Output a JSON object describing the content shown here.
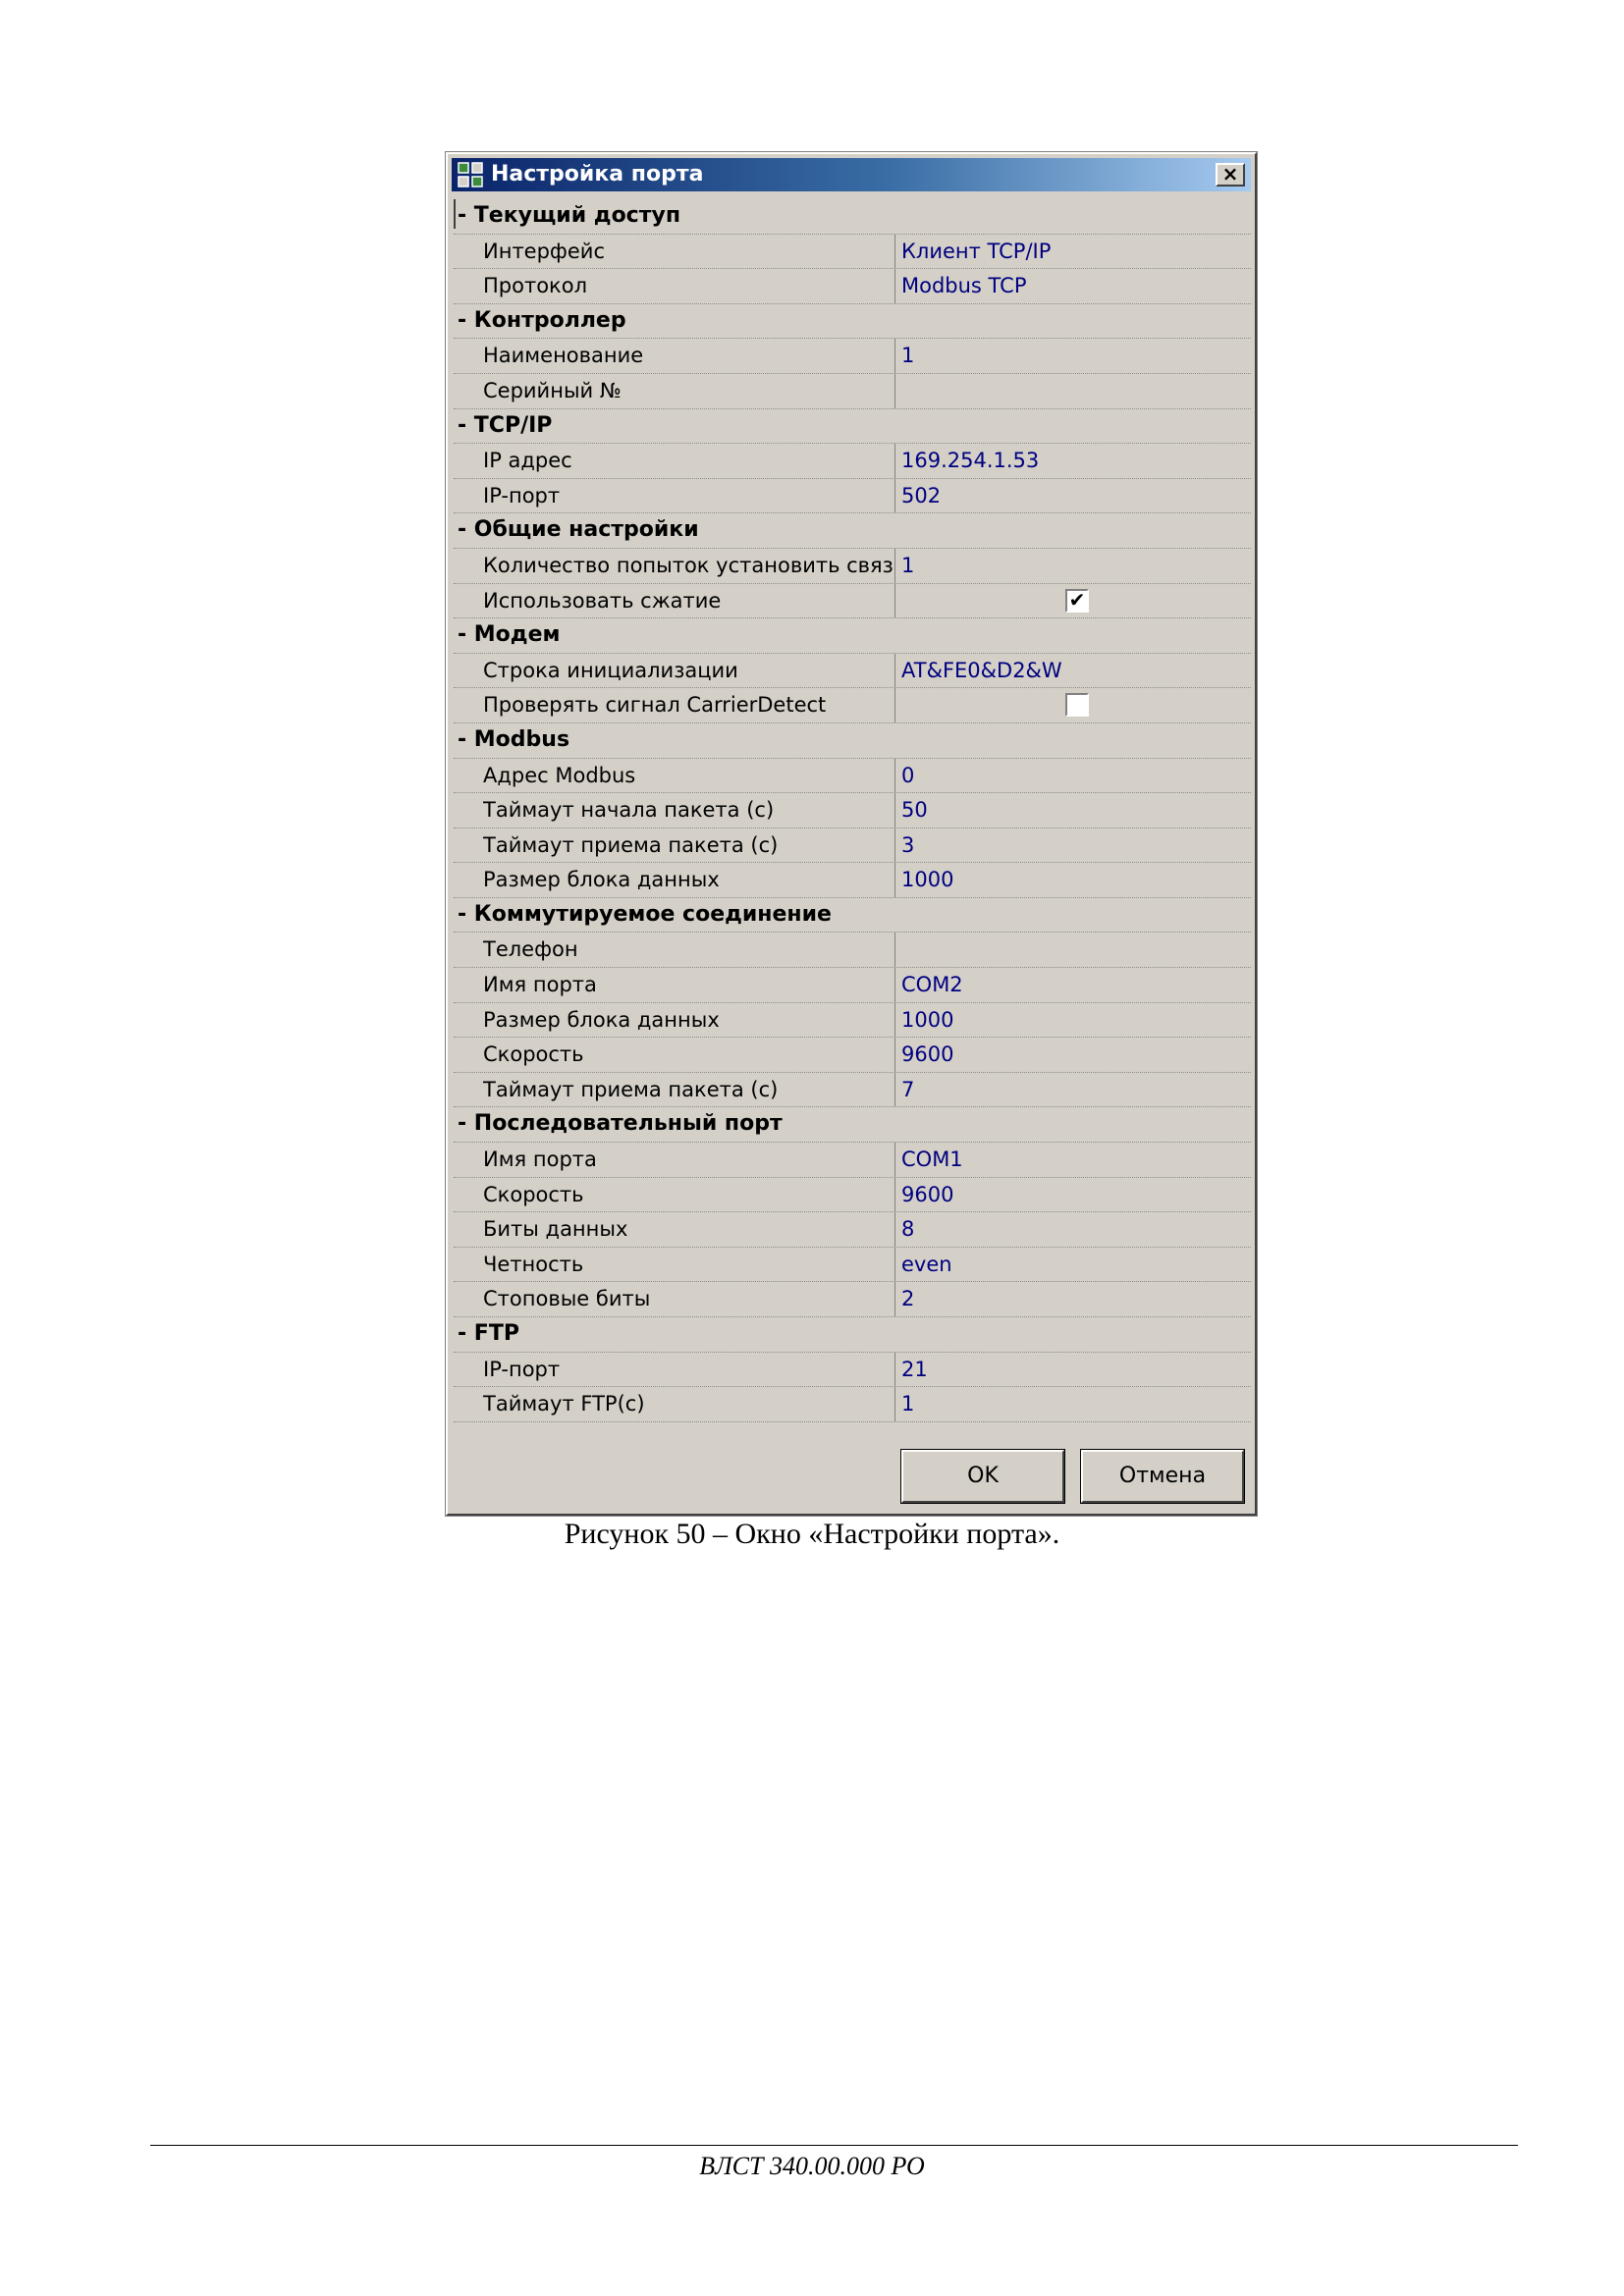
{
  "dialog": {
    "title": "Настройка порта",
    "close_label": "×",
    "sections": [
      {
        "title": "- Текущий доступ",
        "rows": [
          {
            "label": "Интерфейс",
            "value": "Клиент TCP/IP"
          },
          {
            "label": "Протокол",
            "value": "Modbus TCP"
          }
        ]
      },
      {
        "title": "- Контроллер",
        "rows": [
          {
            "label": "Наименование",
            "value": "1"
          },
          {
            "label": "Серийный №",
            "value": ""
          }
        ]
      },
      {
        "title": "- TCP/IP",
        "rows": [
          {
            "label": "IP адрес",
            "value": "169.254.1.53"
          },
          {
            "label": "IP-порт",
            "value": "502"
          }
        ]
      },
      {
        "title": "- Общие настройки",
        "rows": [
          {
            "label": "Количество попыток установить связь",
            "value": "1"
          },
          {
            "label": "Использовать сжатие",
            "checkbox": true,
            "checked": true
          }
        ]
      },
      {
        "title": "- Модем",
        "rows": [
          {
            "label": "Строка инициализации",
            "value": "AT&FE0&D2&W"
          },
          {
            "label": "Проверять сигнал CarrierDetect",
            "checkbox": true,
            "checked": false
          }
        ]
      },
      {
        "title": "- Modbus",
        "rows": [
          {
            "label": "Адрес Modbus",
            "value": "0"
          },
          {
            "label": "Таймаут начала пакета (с)",
            "value": "50"
          },
          {
            "label": "Таймаут приема пакета (с)",
            "value": "3"
          },
          {
            "label": "Размер блока данных",
            "value": "1000"
          }
        ]
      },
      {
        "title": "- Коммутируемое соединение",
        "rows": [
          {
            "label": "Телефон",
            "value": ""
          },
          {
            "label": "Имя порта",
            "value": "COM2"
          },
          {
            "label": "Размер блока данных",
            "value": "1000"
          },
          {
            "label": "Скорость",
            "value": "9600"
          },
          {
            "label": "Таймаут приема пакета (с)",
            "value": "7"
          }
        ]
      },
      {
        "title": "- Последовательный порт",
        "rows": [
          {
            "label": "Имя порта",
            "value": "COM1"
          },
          {
            "label": "Скорость",
            "value": "9600"
          },
          {
            "label": "Биты данных",
            "value": "8"
          },
          {
            "label": "Четность",
            "value": "even"
          },
          {
            "label": "Стоповые биты",
            "value": "2"
          }
        ]
      },
      {
        "title": "- FTP",
        "rows": [
          {
            "label": "IP-порт",
            "value": "21"
          },
          {
            "label": "Таймаут FTP(с)",
            "value": "1"
          }
        ]
      }
    ],
    "ok_label": "OK",
    "cancel_label": "Отмена"
  },
  "caption": "Рисунок 50 – Окно «Настройки порта».",
  "footer": "ВЛСТ 340.00.000 РО",
  "colors": {
    "title_gradient_start": "#0a246a",
    "title_gradient_end": "#a6caf0",
    "value_text": "#000080",
    "dialog_bg": "#d4d0c8"
  }
}
